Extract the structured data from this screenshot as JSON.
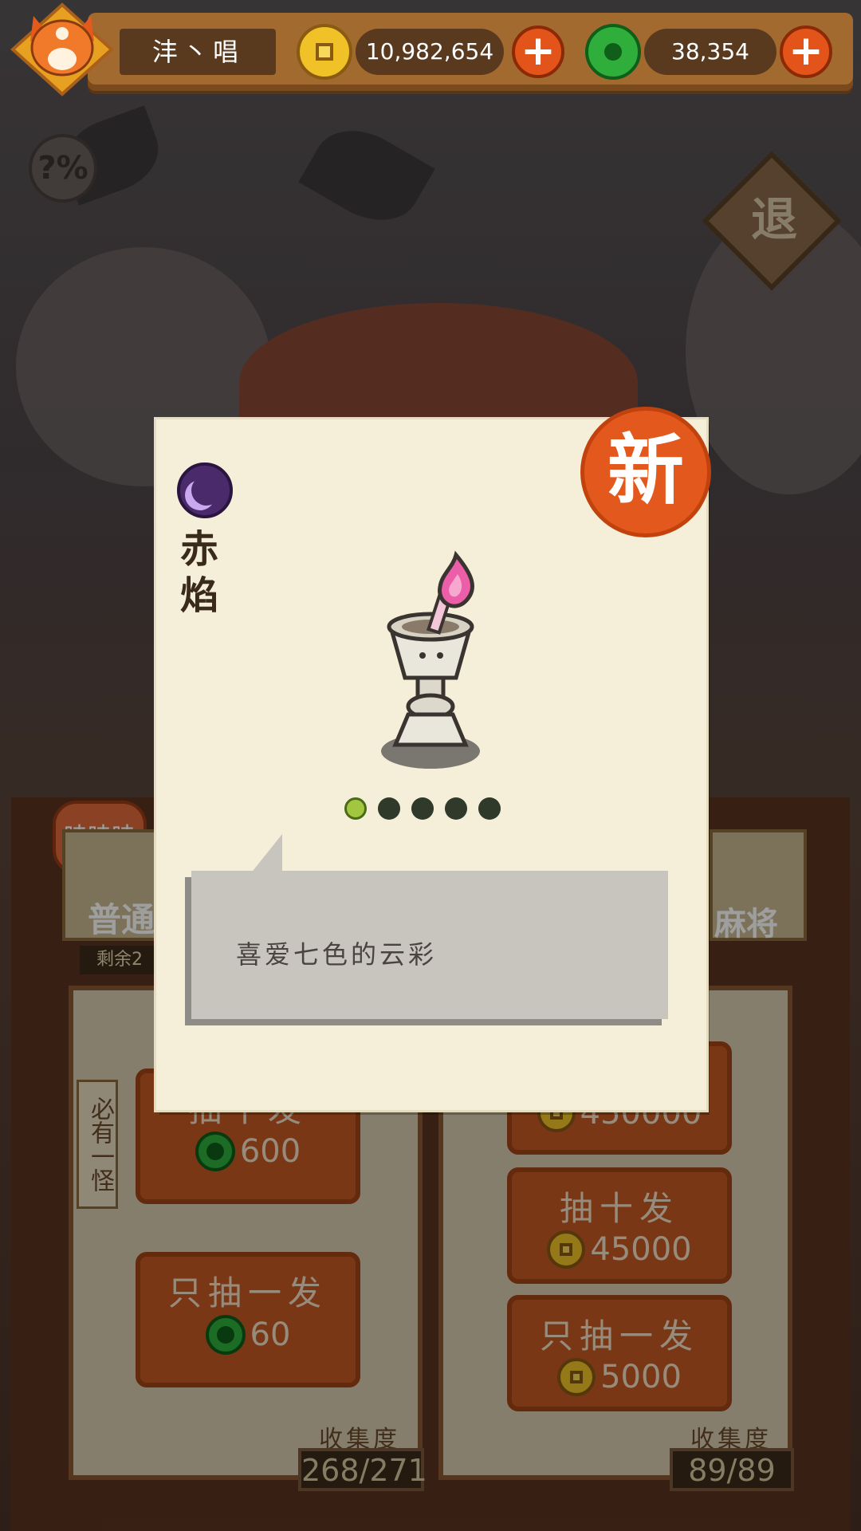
{
  "player": {
    "name": "沣丶唱"
  },
  "currency": {
    "coins": "10,982,654",
    "jade": "38,354"
  },
  "buttons": {
    "exit_label": "退"
  },
  "left_pool": {
    "tag": "哇哇哇",
    "name": "普通",
    "remaining": "剩余2",
    "note": "必有一怪",
    "ten_draw_label": "抽十发",
    "ten_draw_cost": "600",
    "single_draw_label": "只抽一发",
    "single_draw_cost": "60",
    "collection_label": "收集度",
    "collection": "268/271"
  },
  "right_pool": {
    "name": "麻将",
    "big_cost": "450000",
    "ten_draw_label": "抽十发",
    "ten_draw_cost": "45000",
    "single_draw_label": "只抽一发",
    "single_draw_cost": "5000",
    "collection_label": "收集度",
    "collection": "89/89"
  },
  "card": {
    "badge": "新",
    "name_line1": "赤",
    "name_line2": "焰",
    "stars_total": 5,
    "stars_lit": 1,
    "description": "喜爱七色的云彩"
  },
  "colors": {
    "accent_orange": "#e3581c",
    "coin_gold": "#f1c227",
    "jade_green": "#2fae3c"
  }
}
